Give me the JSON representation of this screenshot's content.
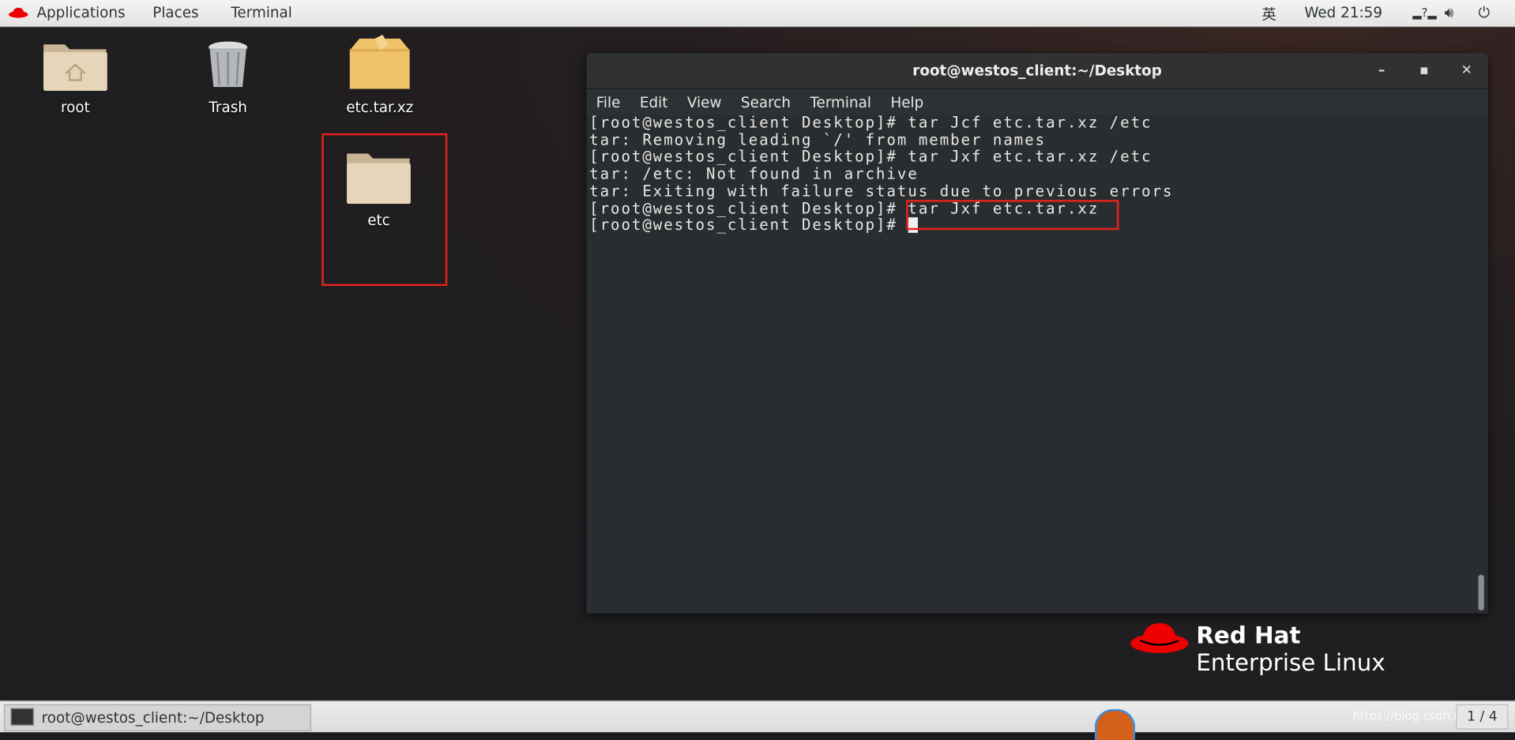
{
  "topbar": {
    "applications": "Applications",
    "places": "Places",
    "terminal": "Terminal",
    "input_method": "英",
    "clock": "Wed 21:59",
    "icons": [
      "network-unknown-icon",
      "volume-icon",
      "power-icon"
    ]
  },
  "desktop": {
    "icons": [
      {
        "label": "root",
        "icon": "home-folder-icon"
      },
      {
        "label": "Trash",
        "icon": "trash-icon"
      },
      {
        "label": "etc.tar.xz",
        "icon": "archive-icon"
      },
      {
        "label": "etc",
        "icon": "folder-icon"
      }
    ]
  },
  "terminal": {
    "title": "root@westos_client:~/Desktop",
    "menu": [
      "File",
      "Edit",
      "View",
      "Search",
      "Terminal",
      "Help"
    ],
    "lines": [
      "[root@westos_client Desktop]# tar Jcf etc.tar.xz /etc",
      "tar: Removing leading `/' from member names",
      "[root@westos_client Desktop]# tar Jxf etc.tar.xz /etc",
      "tar: /etc: Not found in archive",
      "tar: Exiting with failure status due to previous errors",
      "[root@westos_client Desktop]# tar Jxf etc.tar.xz"
    ],
    "prompt": "[root@westos_client Desktop]# "
  },
  "branding": {
    "line1": "Red Hat",
    "line2": "Enterprise Linux"
  },
  "taskbar": {
    "window": "root@westos_client:~/Desktop",
    "workspace": "1 / 4",
    "watermark": "https://blog.csdn.net/..."
  },
  "colors": {
    "highlight": "#e8221c",
    "redhat": "#ee0000"
  }
}
